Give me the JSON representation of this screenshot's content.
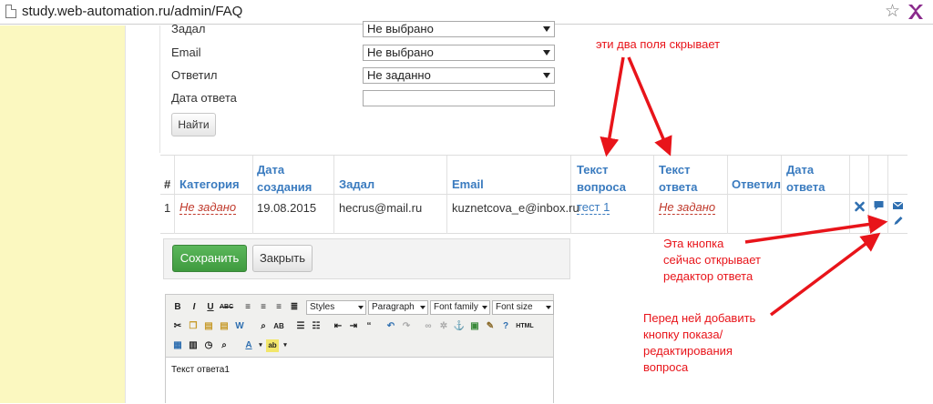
{
  "browser": {
    "url": "study.web-automation.ru/admin/FAQ"
  },
  "filters": [
    {
      "label": "Задал",
      "value": "Не выбрано"
    },
    {
      "label": "Email",
      "value": "Не выбрано"
    },
    {
      "label": "Ответил",
      "value": "Не заданно"
    },
    {
      "label": "Дата ответа",
      "value": ""
    }
  ],
  "find_button": "Найти",
  "table": {
    "headers": {
      "num": "#",
      "category": "Категория",
      "created_1": "Дата",
      "created_2": "создания",
      "asked": "Задал",
      "email": "Email",
      "qtext_1": "Текст",
      "qtext_2": "вопроса",
      "atext_1": "Текст",
      "atext_2": "ответа",
      "answered": "Ответил",
      "adate_1": "Дата",
      "adate_2": "ответа"
    },
    "rows": [
      {
        "num": "1",
        "category": "Не задано",
        "created": "19.08.2015",
        "asked": "hecrus@mail.ru",
        "email": "kuznetcova_e@inbox.ru",
        "question": "тест 1",
        "answer": "Не задано",
        "answered": "",
        "answer_date": ""
      }
    ]
  },
  "buttons": {
    "save": "Сохранить",
    "close": "Закрыть"
  },
  "editor": {
    "styles": "Styles",
    "paragraph": "Paragraph",
    "font_family": "Font family",
    "font_size": "Font size",
    "content": "Текст ответа1"
  },
  "annotations": {
    "top": "эти два поля скрывает",
    "mid_1": "Эта кнопка",
    "mid_2": "сейчас открывает",
    "mid_3": "редактор ответа",
    "bot_1": "Перед ней добавить",
    "bot_2": "кнопку показа/",
    "bot_3": "редактирования",
    "bot_4": "вопроса"
  },
  "colors": {
    "accent_red": "#e8141a",
    "link_blue": "#3a7bbf",
    "sidebar_yellow": "#fbf8c0",
    "save_green": "#4cae4c"
  }
}
